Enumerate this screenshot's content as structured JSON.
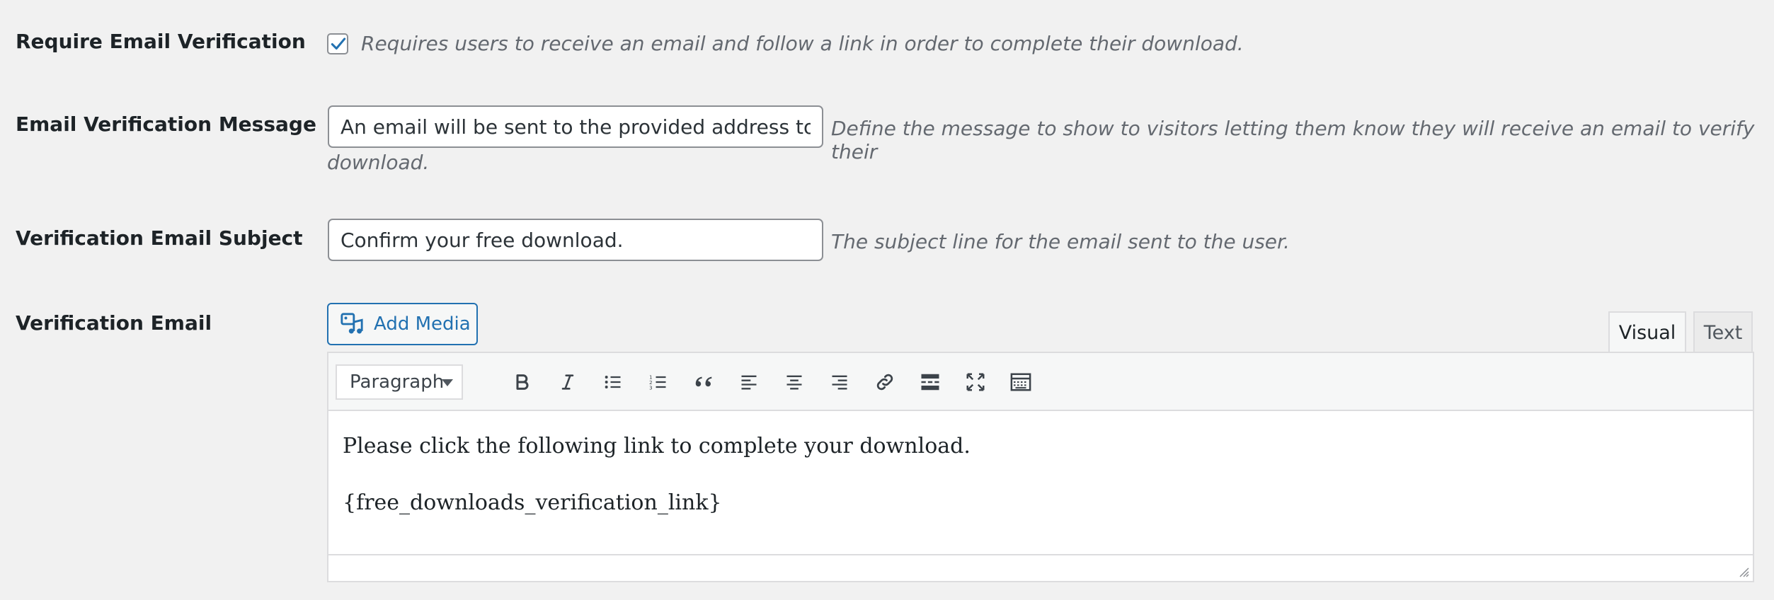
{
  "rows": {
    "require_verification": {
      "label": "Require Email Verification",
      "checked": true,
      "description": "Requires users to receive an email and follow a link in order to complete their download."
    },
    "verification_message": {
      "label": "Email Verification Message",
      "value": "An email will be sent to the provided address to confirm your download.",
      "description_line1": "Define the message to show to visitors letting them know they will receive an email to verify their",
      "description_line2": "download."
    },
    "email_subject": {
      "label": "Verification Email Subject",
      "value": "Confirm your free download.",
      "description": "The subject line for the email sent to the user."
    },
    "verification_email": {
      "label": "Verification Email"
    }
  },
  "editor": {
    "add_media_label": "Add Media",
    "tabs": {
      "visual": "Visual",
      "text": "Text"
    },
    "active_tab": "Visual",
    "format_select": "Paragraph",
    "toolbar_icons": [
      "bold-icon",
      "italic-icon",
      "bulleted-list-icon",
      "numbered-list-icon",
      "blockquote-icon",
      "align-left-icon",
      "align-center-icon",
      "align-right-icon",
      "link-icon",
      "read-more-icon",
      "fullscreen-icon",
      "toolbar-toggle-icon"
    ],
    "content": {
      "line1": "Please click the following link to complete your download.",
      "line2": "{free_downloads_verification_link}"
    }
  },
  "colors": {
    "accent": "#2271b1",
    "background": "#f1f1f1",
    "description_text": "#646970",
    "label_text": "#1d2327"
  }
}
